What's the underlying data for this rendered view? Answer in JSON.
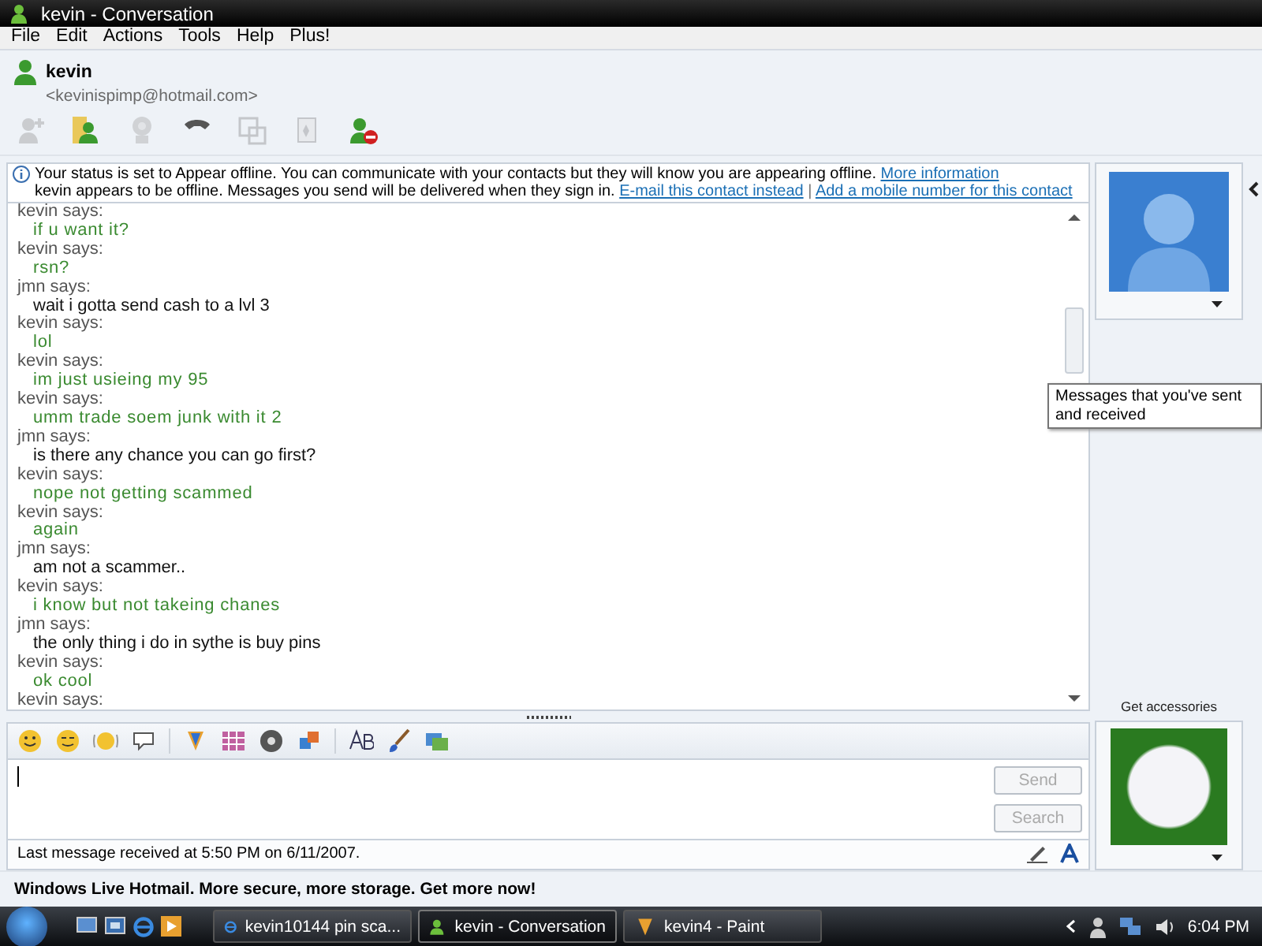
{
  "window": {
    "title": "kevin - Conversation"
  },
  "menu": [
    "File",
    "Edit",
    "Actions",
    "Tools",
    "Help",
    "Plus!"
  ],
  "contact": {
    "name": "kevin",
    "email": "<kevinispimp@hotmail.com>"
  },
  "toolbar": [
    {
      "kind": "invite",
      "disabled": true
    },
    {
      "kind": "share",
      "disabled": false
    },
    {
      "kind": "webcam",
      "disabled": true
    },
    {
      "kind": "call",
      "disabled": false
    },
    {
      "kind": "activity",
      "disabled": true
    },
    {
      "kind": "game",
      "disabled": true
    },
    {
      "kind": "block",
      "disabled": false
    }
  ],
  "info": {
    "line_1": "Your status is set to Appear offline. You can communicate with your contacts but they will know you are appearing offline.",
    "link_1": "More information",
    "line_2": "kevin appears to be offline. Messages you send will be delivered when they sign in.",
    "link_2": "E-mail this contact instead",
    "separator": "|",
    "link_3": "Add a mobile number for this contact"
  },
  "messages": [
    {
      "sender": "kevin says:",
      "text": "if u want it?",
      "kind": "contact"
    },
    {
      "sender": "kevin says:",
      "text": "rsn?",
      "kind": "contact"
    },
    {
      "sender": "jmn says:",
      "text": "wait i gotta send cash to a lvl 3",
      "kind": "self"
    },
    {
      "sender": "kevin says:",
      "text": "lol",
      "kind": "contact"
    },
    {
      "sender": "kevin says:",
      "text": "im just usieing my 95",
      "kind": "contact"
    },
    {
      "sender": "kevin says:",
      "text": "umm trade soem junk with it 2",
      "kind": "contact"
    },
    {
      "sender": "jmn says:",
      "text": "is there any chance you can go first?",
      "kind": "self"
    },
    {
      "sender": "kevin says:",
      "text": "nope not getting scammed",
      "kind": "contact"
    },
    {
      "sender": "kevin says:",
      "text": "again",
      "kind": "contact"
    },
    {
      "sender": "jmn says:",
      "text": "am not a scammer..",
      "kind": "self"
    },
    {
      "sender": "kevin says:",
      "text": "i know but not takeing chanes",
      "kind": "contact"
    },
    {
      "sender": "jmn says:",
      "text": "the only thing i do in sythe is buy pins",
      "kind": "self"
    },
    {
      "sender": "kevin says:",
      "text": "ok cool",
      "kind": "contact"
    },
    {
      "sender": "kevin says:",
      "kind": "contact"
    }
  ],
  "tooltip": "Messages that you've sent and received",
  "buttons": [
    {
      "label": "Send",
      "disabled": true
    },
    {
      "label": "Search",
      "disabled": true
    }
  ],
  "status_bar": "Last message received at 5:50 PM on 6/11/2007.",
  "accessories": "Get accessories",
  "ad": "Windows Live Hotmail. More secure, more storage. Get more now!",
  "taskbar": {
    "tasks": [
      {
        "label": "kevin10144 pin sca...",
        "kind": "browser",
        "selected": false
      },
      {
        "label": "kevin - Conversation",
        "kind": "messenger",
        "selected": true
      },
      {
        "label": "kevin4 - Paint",
        "kind": "paint",
        "selected": false
      }
    ],
    "time": "6:04 PM"
  }
}
